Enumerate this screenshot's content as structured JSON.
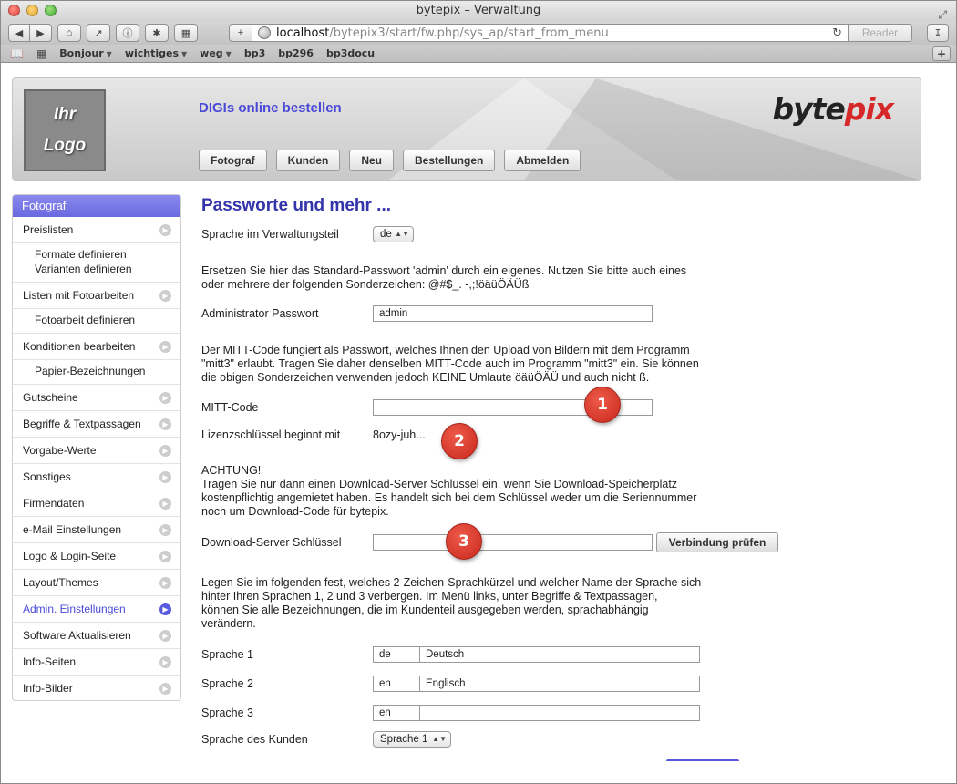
{
  "browser": {
    "title": "bytepix – Verwaltung",
    "url_host": "localhost",
    "url_path": "/bytepix3/start/fw.php/sys_ap/start_from_menu",
    "reader_label": "Reader",
    "bookmarks": [
      {
        "label": "Bonjour",
        "menu": true
      },
      {
        "label": "wichtiges",
        "menu": true
      },
      {
        "label": "weg",
        "menu": true
      },
      {
        "label": "bp3",
        "menu": false
      },
      {
        "label": "bp296",
        "menu": false
      },
      {
        "label": "bp3docu",
        "menu": false
      }
    ]
  },
  "banner": {
    "logo_line1": "Ihr",
    "logo_line2": "Logo",
    "title": "DIGIs online bestellen",
    "brand_a": "byte",
    "brand_b": "pix",
    "nav": [
      "Fotograf",
      "Kunden",
      "Neu",
      "Bestellungen",
      "Abmelden"
    ]
  },
  "sidebar": {
    "header": "Fotograf",
    "items": [
      {
        "label": "Preislisten",
        "subs": [
          "Formate definieren",
          "Varianten definieren"
        ]
      },
      {
        "label": "Listen mit Fotoarbeiten",
        "subs": [
          "Fotoarbeit definieren"
        ]
      },
      {
        "label": "Konditionen bearbeiten",
        "subs": [
          "Papier-Bezeichnungen"
        ]
      },
      {
        "label": "Gutscheine"
      },
      {
        "label": "Begriffe & Textpassagen"
      },
      {
        "label": "Vorgabe-Werte"
      },
      {
        "label": "Sonstiges"
      },
      {
        "label": "Firmendaten"
      },
      {
        "label": "e-Mail Einstellungen"
      },
      {
        "label": "Logo & Login-Seite"
      },
      {
        "label": "Layout/Themes"
      },
      {
        "label": "Admin. Einstellungen",
        "active": true
      },
      {
        "label": "Software Aktualisieren"
      },
      {
        "label": "Info-Seiten"
      },
      {
        "label": "Info-Bilder"
      }
    ]
  },
  "main": {
    "title": "Passworte und mehr ...",
    "lang_label": "Sprache im Verwaltungsteil",
    "lang_value": "de",
    "pw_intro_1": "Ersetzen Sie hier das Standard-Passwort 'admin' durch ein eigenes. Nutzen Sie bitte auch eines",
    "pw_intro_2": "oder mehrere der folgenden Sonderzeichen: @#$_. -,;!öäüÖÄÜß",
    "admin_pw_label": "Administrator Passwort",
    "admin_pw_value": "admin",
    "mitt_intro_1": "Der MITT-Code fungiert als Passwort, welches Ihnen den Upload von Bildern mit dem Programm",
    "mitt_intro_2": "\"mitt3\" erlaubt. Tragen Sie daher denselben MITT-Code auch im Programm \"mitt3\" ein. Sie können",
    "mitt_intro_3": "die obigen Sonderzeichen verwenden jedoch KEINE Umlaute öäüÖÄÜ und auch nicht ß.",
    "mitt_label": "MITT-Code",
    "mitt_value": "",
    "license_label": "Lizenzschlüssel beginnt mit",
    "license_value": "8ozy-juh...",
    "warn_title": "ACHTUNG!",
    "warn_1": "Tragen Sie nur dann einen Download-Server Schlüssel ein, wenn Sie Download-Speicherplatz",
    "warn_2": "kostenpflichtig angemietet haben. Es handelt sich bei dem Schlüssel weder um die Seriennummer",
    "warn_3": "noch um Download-Code für bytepix.",
    "dl_label": "Download-Server Schlüssel",
    "dl_value": "",
    "check_button": "Verbindung prüfen",
    "langs_intro_1": "Legen Sie im folgenden fest, welches 2-Zeichen-Sprachkürzel und welcher Name der Sprache sich",
    "langs_intro_2": "hinter Ihren Sprachen 1, 2 und 3 verbergen. Im Menü links, unter Begriffe & Textpassagen,",
    "langs_intro_3": "können Sie alle Bezeichnungen, die im Kundenteil ausgegeben werden, sprachabhängig",
    "langs_intro_4": "verändern.",
    "languages": [
      {
        "label": "Sprache 1",
        "code": "de",
        "name": "Deutsch"
      },
      {
        "label": "Sprache 2",
        "code": "en",
        "name": "Englisch"
      },
      {
        "label": "Sprache 3",
        "code": "en",
        "name": ""
      }
    ],
    "customer_lang_label": "Sprache des Kunden",
    "customer_lang_value": "Sprache 1"
  },
  "callouts": [
    "1",
    "2",
    "3"
  ]
}
